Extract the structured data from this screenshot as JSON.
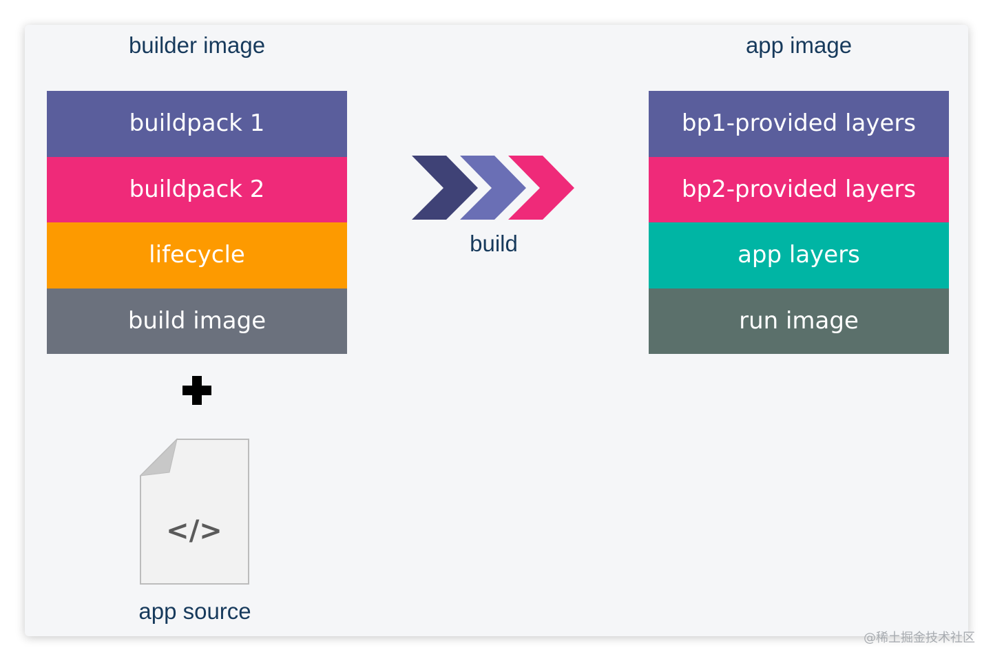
{
  "builder": {
    "title": "builder image",
    "layers": [
      {
        "label": "buildpack 1",
        "color": "#5a5e9c"
      },
      {
        "label": "buildpack 2",
        "color": "#ef2a79"
      },
      {
        "label": "lifecycle",
        "color": "#fd9a00"
      },
      {
        "label": "build image",
        "color": "#6b717d"
      }
    ]
  },
  "app": {
    "title": "app image",
    "layers": [
      {
        "label": "bp1-provided layers",
        "color": "#5a5e9c"
      },
      {
        "label": "bp2-provided layers",
        "color": "#ef2a79"
      },
      {
        "label": "app layers",
        "color": "#00b5a4"
      },
      {
        "label": "run image",
        "color": "#5b706b"
      }
    ]
  },
  "build": {
    "label": "build",
    "chevron_colors": [
      "#3f4276",
      "#6a6fb5",
      "#ef2a79"
    ]
  },
  "plus_icon": "plus-icon",
  "source": {
    "label": "app source",
    "icon": "code-file-icon",
    "glyph": "</>"
  },
  "watermark": "@稀土掘金技术社区"
}
